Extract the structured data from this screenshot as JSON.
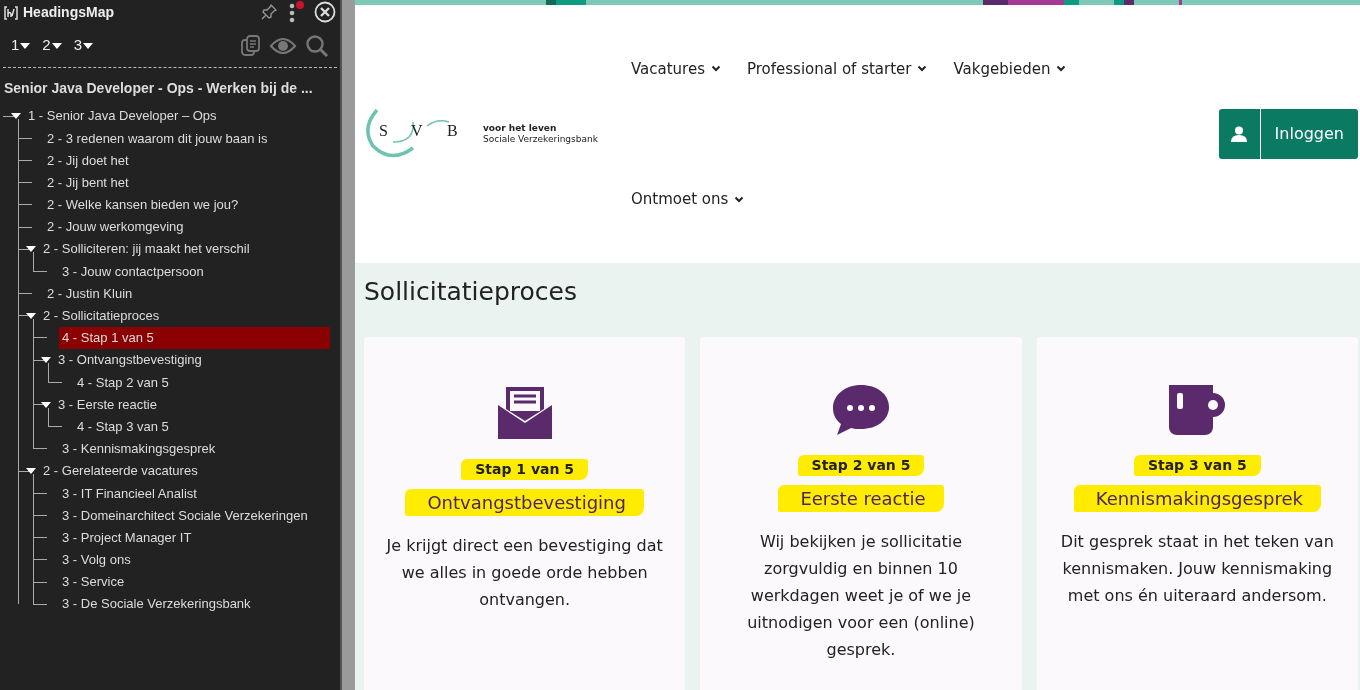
{
  "panel": {
    "title": "HeadingsMap",
    "levels": [
      "1",
      "2",
      "3"
    ],
    "notification": true,
    "page_title": "Senior Java Developer - Ops - Werken bij de ...",
    "tree": [
      {
        "label": "1 - Senior Java Developer – Ops",
        "selected": false,
        "expanded": true,
        "children": [
          {
            "label": "2 - 3 redenen waarom dit jouw baan is",
            "selected": false
          },
          {
            "label": "2 - Jij doet het",
            "selected": false
          },
          {
            "label": "2 - Jij bent het",
            "selected": false
          },
          {
            "label": "2 - Welke kansen bieden we jou?",
            "selected": false
          },
          {
            "label": "2 - Jouw werkomgeving",
            "selected": false
          },
          {
            "label": "2 - Solliciteren: jij maakt het verschil",
            "selected": false,
            "expanded": true,
            "children": [
              {
                "label": "3 - Jouw contactpersoon",
                "selected": false
              }
            ]
          },
          {
            "label": "2 - Justin Kluin",
            "selected": false
          },
          {
            "label": "2 - Sollicitatieproces",
            "selected": false,
            "expanded": true,
            "children": [
              {
                "label": "4 - Stap 1 van 5",
                "selected": true
              },
              {
                "label": "3 - Ontvangstbevestiging",
                "selected": false,
                "expanded": true,
                "children": [
                  {
                    "label": "4 - Stap 2 van 5",
                    "selected": false
                  }
                ]
              },
              {
                "label": "3 - Eerste reactie",
                "selected": false,
                "expanded": true,
                "children": [
                  {
                    "label": "4 - Stap 3 van 5",
                    "selected": false
                  }
                ]
              },
              {
                "label": "3 - Kennismakingsgesprek",
                "selected": false
              }
            ]
          },
          {
            "label": "2 - Gerelateerde vacatures",
            "selected": false,
            "expanded": true,
            "children": [
              {
                "label": "3 - IT Financieel Analist",
                "selected": false
              },
              {
                "label": "3 - Domeinarchitect Sociale Verzekeringen",
                "selected": false
              },
              {
                "label": "3 - Project Manager IT",
                "selected": false
              },
              {
                "label": "3 - Volg ons",
                "selected": false
              },
              {
                "label": "3 - Service",
                "selected": false
              },
              {
                "label": "3 - De Sociale Verzekeringsbank",
                "selected": false
              }
            ]
          }
        ]
      }
    ]
  },
  "site": {
    "logo": {
      "letters": [
        "S",
        "V",
        "B"
      ],
      "tagline": "voor het leven",
      "name": "Sociale Verzekeringsbank"
    },
    "nav": [
      "Vacatures",
      "Professional of starter",
      "Vakgebieden",
      "Ontmoet ons"
    ],
    "login_button": "Inloggen",
    "section_title": "Sollicitatieproces",
    "steps": [
      {
        "kind": "envelope",
        "step": "Stap 1 van 5",
        "title": "Ontvangstbevestiging",
        "text": "Je krijgt direct een bevestiging dat we alles in goede orde hebben ontvangen."
      },
      {
        "kind": "chat",
        "step": "Stap 2 van 5",
        "title": "Eerste reactie",
        "text": "Wij bekijken je sollicitatie zorgvuldig en binnen 10 werkdagen weet je of we je uitnodigen voor een (online) gesprek."
      },
      {
        "kind": "mug",
        "step": "Stap 3 van 5",
        "title": "Kennismakingsgesprek",
        "text": "Dit gesprek staat in het teken van kennismaken. Jouw kennismaking met ons én uiteraard andersom."
      }
    ]
  }
}
